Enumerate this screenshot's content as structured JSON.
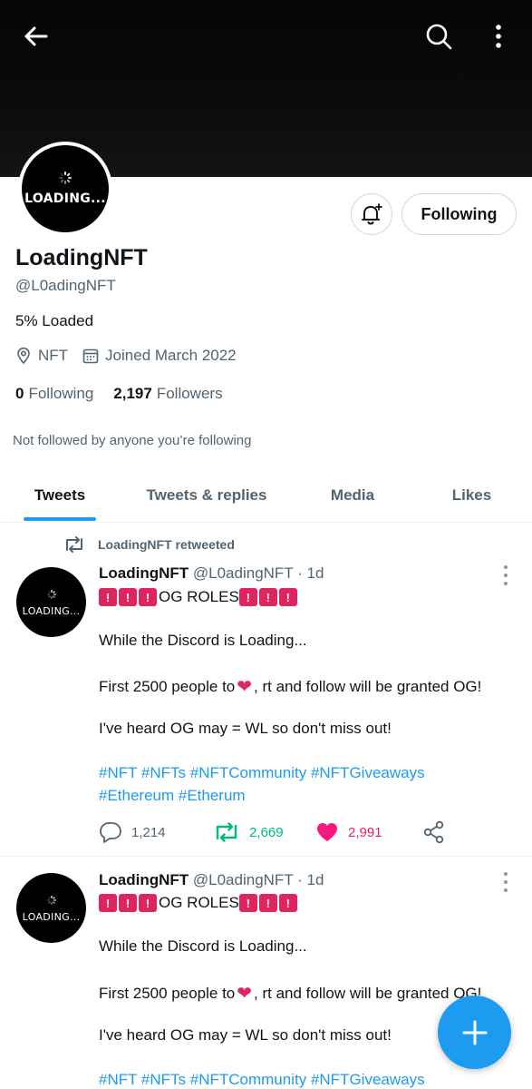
{
  "profile": {
    "name": "LoadingNFT",
    "handle": "@L0adingNFT",
    "bio": "5% Loaded",
    "location": "NFT",
    "joined": "Joined March 2022",
    "following_count": "0",
    "following_label": "Following",
    "followers_count": "2,197",
    "followers_label": "Followers",
    "not_followed": "Not followed by anyone you’re following",
    "avatar_text": "LOADING..."
  },
  "header": {
    "follow_button": "Following",
    "back_icon": "back-arrow-icon",
    "search_icon": "search-icon",
    "more_icon": "more-vertical-icon",
    "bell_icon": "notification-bell-plus-icon"
  },
  "tabs": [
    {
      "label": "Tweets",
      "active": true
    },
    {
      "label": "Tweets & replies",
      "active": false
    },
    {
      "label": "Media",
      "active": false
    },
    {
      "label": "Likes",
      "active": false
    }
  ],
  "tweets": [
    {
      "retweet_label": "LoadingNFT retweeted",
      "author": "LoadingNFT",
      "handle_time": "@L0adingNFT · 1d",
      "avatar_text": "LOADING...",
      "line1_text": "OG ROLES",
      "line2": "While the Discord is Loading...",
      "line3_pre": "First 2500 people to",
      "line3_post": ", rt and follow will be granted OG!",
      "line4": "I've heard OG may = WL so don't miss out!",
      "tags1": "#NFT #NFTs #NFTCommunity #NFTGiveaways",
      "tags2": "#Ethereum #Etherum",
      "replies": "1,214",
      "retweets": "2,669",
      "likes": "2,991"
    },
    {
      "author": "LoadingNFT",
      "handle_time": "@L0adingNFT · 1d",
      "avatar_text": "LOADING...",
      "line1_text": "OG ROLES",
      "line2": "While the Discord is Loading...",
      "line3_pre": "First 2500 people to",
      "line3_post": ", rt and follow will be granted OG!",
      "line4": "I've heard OG may = WL so don't miss out!",
      "tags1": "#NFT #NFTs #NFTCommunity #NFTGiveaways"
    }
  ],
  "colors": {
    "accent": "#1d9bf0",
    "retweet_green": "#00ba7c",
    "like_pink": "#f91880",
    "muted": "#536471"
  },
  "fab": {
    "icon": "compose-plus-icon"
  }
}
